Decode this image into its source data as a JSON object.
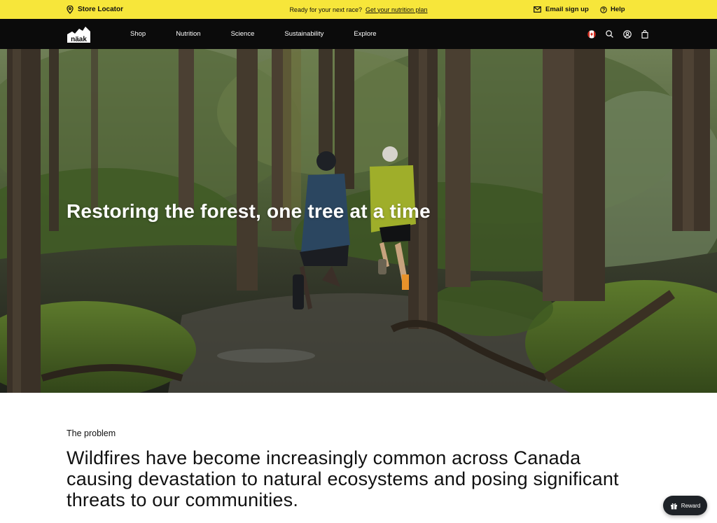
{
  "topbar": {
    "store_locator": "Store Locator",
    "promo_text": "Ready for your next race?",
    "promo_link": "Get your nutrition plan",
    "email_signup": "Email sign up",
    "help": "Help"
  },
  "nav": {
    "logo_text": "näak",
    "items": [
      "Shop",
      "Nutrition",
      "Science",
      "Sustainability",
      "Explore"
    ],
    "icons": [
      "canada-flag-icon",
      "search-icon",
      "account-icon",
      "cart-icon"
    ]
  },
  "hero": {
    "title": "Restoring the forest, one tree at a time"
  },
  "content": {
    "eyebrow": "The problem",
    "headline": "Wildfires have become increasingly common across Canada causing devastation to natural ecosystems and posing significant threats to our communities."
  },
  "reward": {
    "label": "Reward"
  },
  "colors": {
    "topbar_bg": "#f7e63a",
    "nav_bg": "#0b0b0b",
    "reward_bg": "#1e2227"
  }
}
